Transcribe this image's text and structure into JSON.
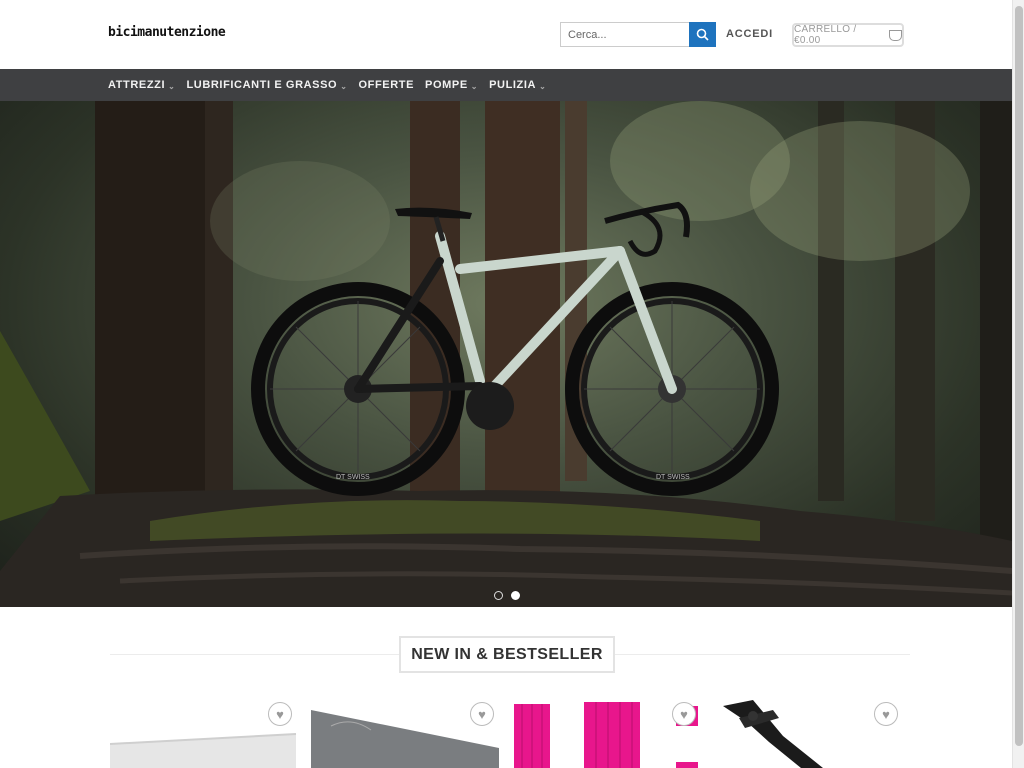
{
  "header": {
    "logo_text": "bicimanutenzione",
    "search_placeholder": "Cerca...",
    "login_label": "ACCEDI",
    "cart_label": "CARRELLO / €0.00"
  },
  "nav": {
    "items": [
      {
        "label": "ATTREZZI",
        "has_dropdown": true
      },
      {
        "label": "LUBRIFICANTI E GRASSO",
        "has_dropdown": true
      },
      {
        "label": "OFFERTE",
        "has_dropdown": false
      },
      {
        "label": "POMPE",
        "has_dropdown": true
      },
      {
        "label": "PULIZIA",
        "has_dropdown": true
      }
    ]
  },
  "hero": {
    "slide_count": 2,
    "active_slide": 2,
    "wheel_brand_text": "DT SWISS"
  },
  "section": {
    "title": "NEW IN & BESTSELLER"
  },
  "colors": {
    "accent": "#1e73be",
    "nav_bg": "#3f4042"
  }
}
